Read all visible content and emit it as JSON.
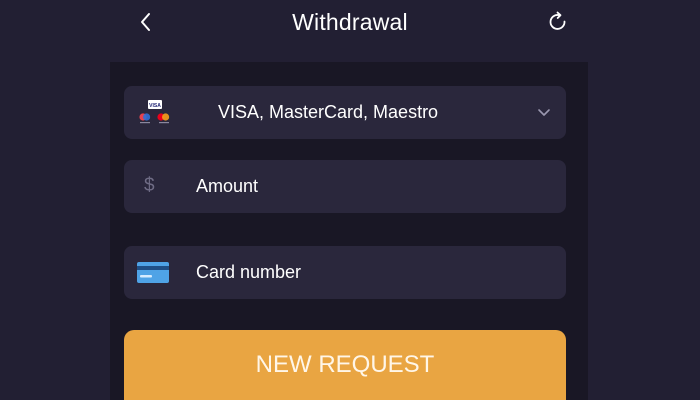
{
  "header": {
    "title": "Withdrawal",
    "back_icon": "chevron-left-icon",
    "refresh_icon": "refresh-icon"
  },
  "payment_method": {
    "selected": "VISA, MasterCard, Maestro",
    "logo_icon": "cards-logo-icon",
    "logo_text": "VISA",
    "dropdown_icon": "chevron-down-icon"
  },
  "amount_field": {
    "placeholder": "Amount",
    "icon": "dollar-icon",
    "icon_glyph": "$"
  },
  "card_field": {
    "placeholder": "Card number",
    "icon": "credit-card-icon"
  },
  "submit": {
    "label": "NEW REQUEST"
  },
  "colors": {
    "background": "#221f33",
    "panel": "#191725",
    "field": "#2a273c",
    "accent": "#e9a542",
    "text": "#ffffff",
    "muted_icon": "#6f6c85"
  }
}
